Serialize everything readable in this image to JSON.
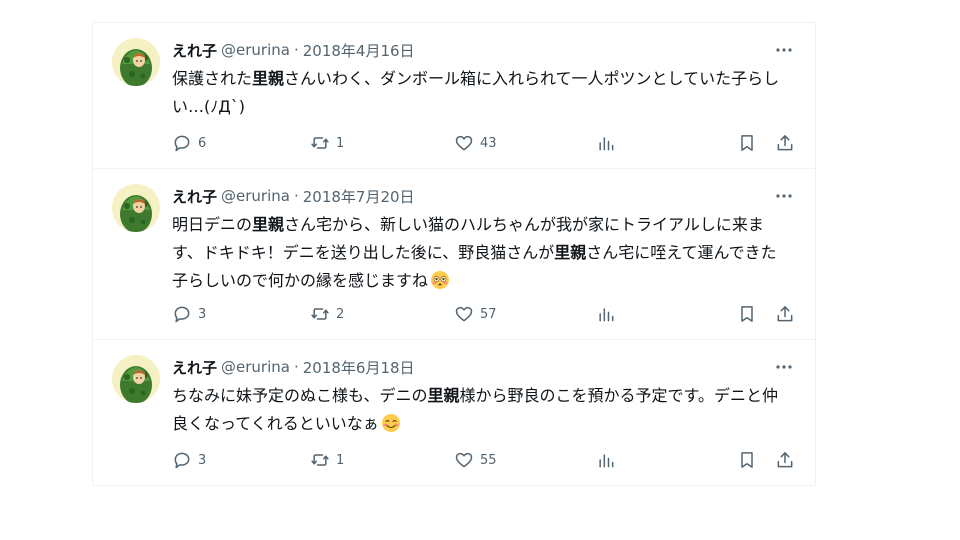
{
  "author": {
    "name": "えれ子",
    "handle": "@erurina",
    "separator": "·"
  },
  "tweets": [
    {
      "date": "2018年4月16日",
      "text_segments": [
        {
          "t": "保護された",
          "b": false
        },
        {
          "t": "里親",
          "b": true
        },
        {
          "t": "さんいわく、ダンボール箱に入れられて一人ポツンとしていた子らしい…(ﾉД`)",
          "b": false
        }
      ],
      "emoji": "",
      "replies": "6",
      "retweets": "1",
      "likes": "43"
    },
    {
      "date": "2018年7月20日",
      "text_segments": [
        {
          "t": "明日デニの",
          "b": false
        },
        {
          "t": "里親",
          "b": true
        },
        {
          "t": "さん宅から、新しい猫のハルちゃんが我が家にトライアルしに来ます、ドキドキ！デニを送り出した後に、野良猫さんが",
          "b": false
        },
        {
          "t": "里親",
          "b": true
        },
        {
          "t": "さん宅に咥えて運んできた子らしいので何かの縁を感じますね",
          "b": false
        }
      ],
      "emoji": "flushed-face",
      "replies": "3",
      "retweets": "2",
      "likes": "57"
    },
    {
      "date": "2018年6月18日",
      "text_segments": [
        {
          "t": "ちなみに妹予定のぬこ様も、デニの",
          "b": false
        },
        {
          "t": "里親",
          "b": true
        },
        {
          "t": "様から野良のこを預かる予定です。デニと仲良くなってくれるといいなぁ",
          "b": false
        }
      ],
      "emoji": "smiling-face",
      "replies": "3",
      "retweets": "1",
      "likes": "55"
    }
  ],
  "icons": {
    "more": "more-horizontal-icon",
    "reply": "reply-icon",
    "retweet": "retweet-icon",
    "like": "heart-icon",
    "views": "views-chart-icon",
    "bookmark": "bookmark-icon",
    "share": "share-icon"
  },
  "colors": {
    "text": "#0f1419",
    "secondary": "#536471",
    "border": "#eff3f4"
  }
}
